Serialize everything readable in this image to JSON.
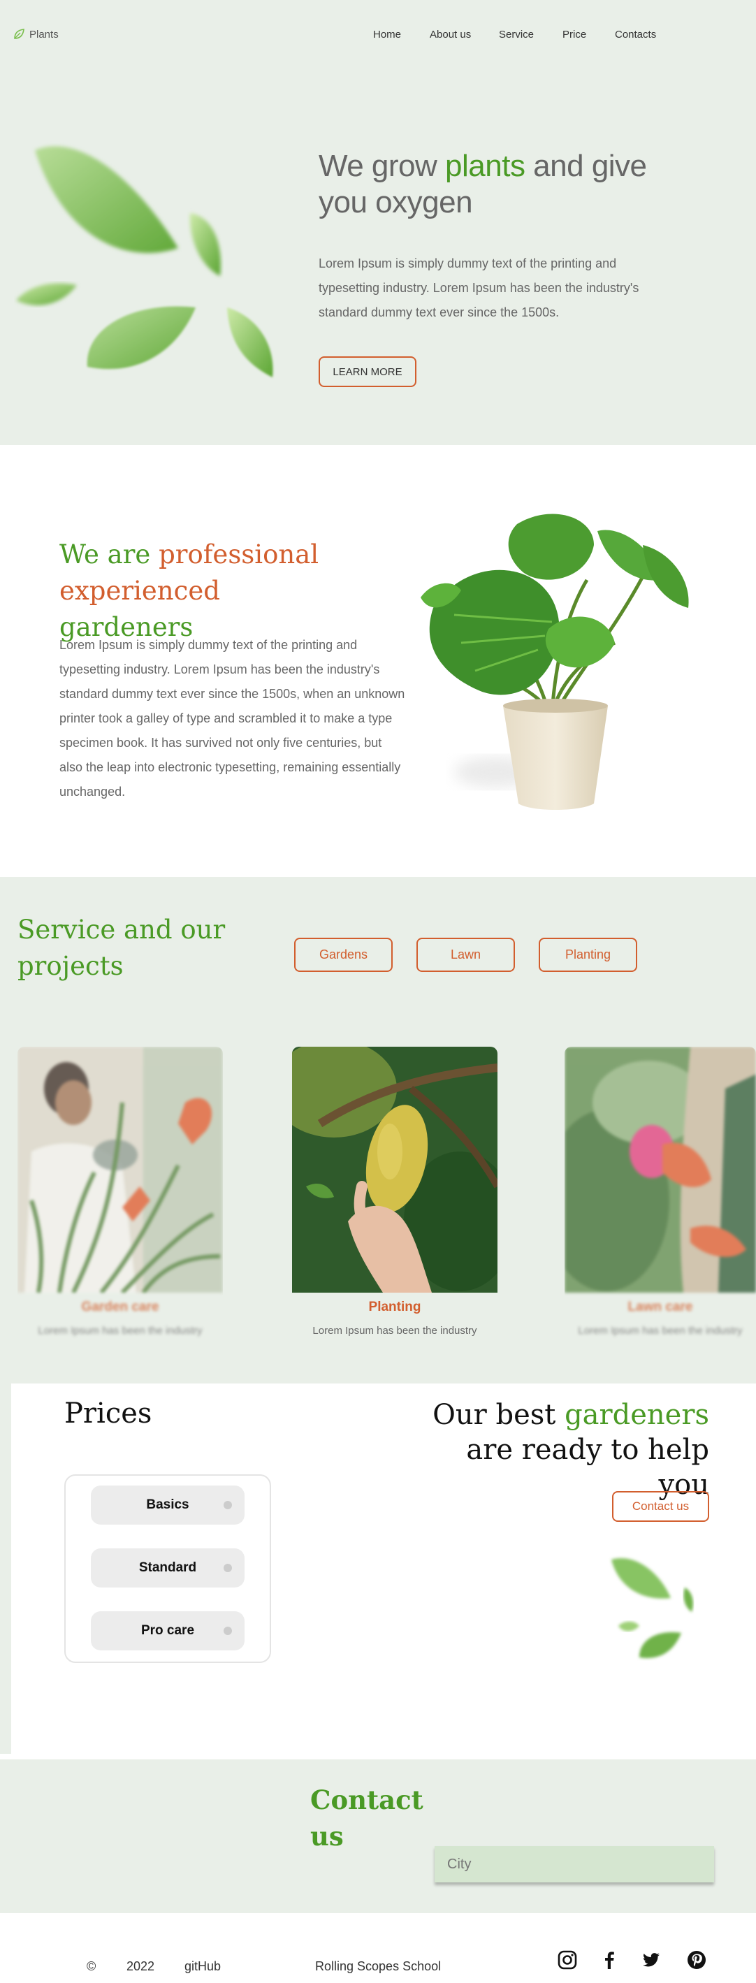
{
  "header": {
    "logo_text": "Plants",
    "nav": [
      "Home",
      "About us",
      "Service",
      "Price",
      "Contacts"
    ]
  },
  "hero": {
    "title_part1": "We grow ",
    "title_highlight": "plants",
    "title_part2": " and give you oxygen",
    "text": "Lorem Ipsum is simply dummy text of the printing and typesetting industry. Lorem Ipsum has been the industry's standard dummy text ever since the 1500s.",
    "button": "LEARN MORE"
  },
  "about": {
    "title_part1": "We are ",
    "title_highlight1": "professional experienced",
    "title_part2": " gardeners",
    "text": "Lorem Ipsum is simply dummy text of the printing and typesetting industry. Lorem Ipsum has been the industry's standard dummy text ever since the 1500s, when an unknown printer took a galley of type and scrambled it to make a type specimen book. It has survived not only five centuries, but also the leap into electronic typesetting, remaining essentially unchanged."
  },
  "service": {
    "title": "Service and our projects",
    "filters": [
      "Gardens",
      "Lawn",
      "Planting"
    ],
    "cards": [
      {
        "title": "Garden care",
        "text": "Lorem Ipsum has been the industry"
      },
      {
        "title": "Planting",
        "text": "Lorem Ipsum has been the industry"
      },
      {
        "title": "Lawn care",
        "text": "Lorem Ipsum has been the industry"
      }
    ]
  },
  "prices": {
    "title": "Prices",
    "plans": [
      "Basics",
      "Standard",
      "Pro care"
    ]
  },
  "helpers": {
    "title_part1": "Our best ",
    "title_highlight": "gardeners",
    "title_part2": " are ready to help you",
    "button": "Contact us"
  },
  "contact": {
    "title": "Contact us",
    "city_placeholder": "City"
  },
  "footer": {
    "copyright": "©",
    "year": "2022",
    "github": "gitHub",
    "school": "Rolling Scopes School"
  },
  "colors": {
    "accent_green": "#4a9a25",
    "accent_orange": "#d25e2e",
    "section_bg": "#e9efe8"
  },
  "icons": {
    "logo": "leaf-icon",
    "social": [
      "instagram-icon",
      "facebook-icon",
      "twitter-icon",
      "pinterest-icon"
    ]
  }
}
